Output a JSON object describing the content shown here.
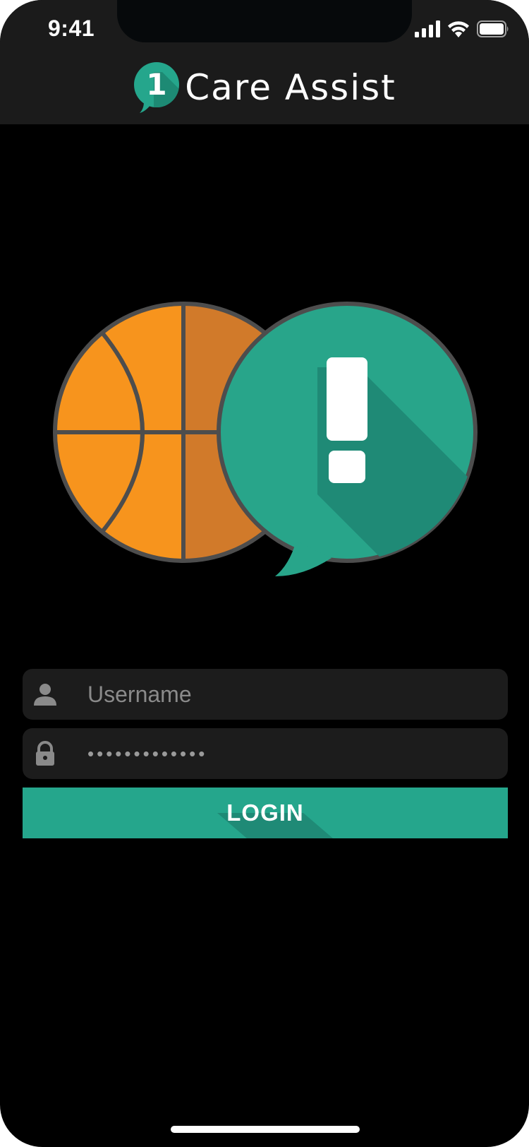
{
  "status_bar": {
    "time": "9:41"
  },
  "header": {
    "logo_digit": "1",
    "app_name": "Care Assist"
  },
  "login_form": {
    "username_placeholder": "Username",
    "username_value": "",
    "password_value": "•••••••••••••",
    "login_label": "LOGIN"
  },
  "colors": {
    "accent": "#25a68c",
    "ball": "#f7941d",
    "background": "#000000",
    "header": "#1b1b1b",
    "field": "#1c1c1c"
  },
  "icons": {
    "username": "person-icon",
    "password": "lock-icon",
    "signal": "cellular-signal-icon",
    "wifi": "wifi-icon",
    "battery": "battery-icon",
    "hero": "basketball-alert-icon"
  }
}
